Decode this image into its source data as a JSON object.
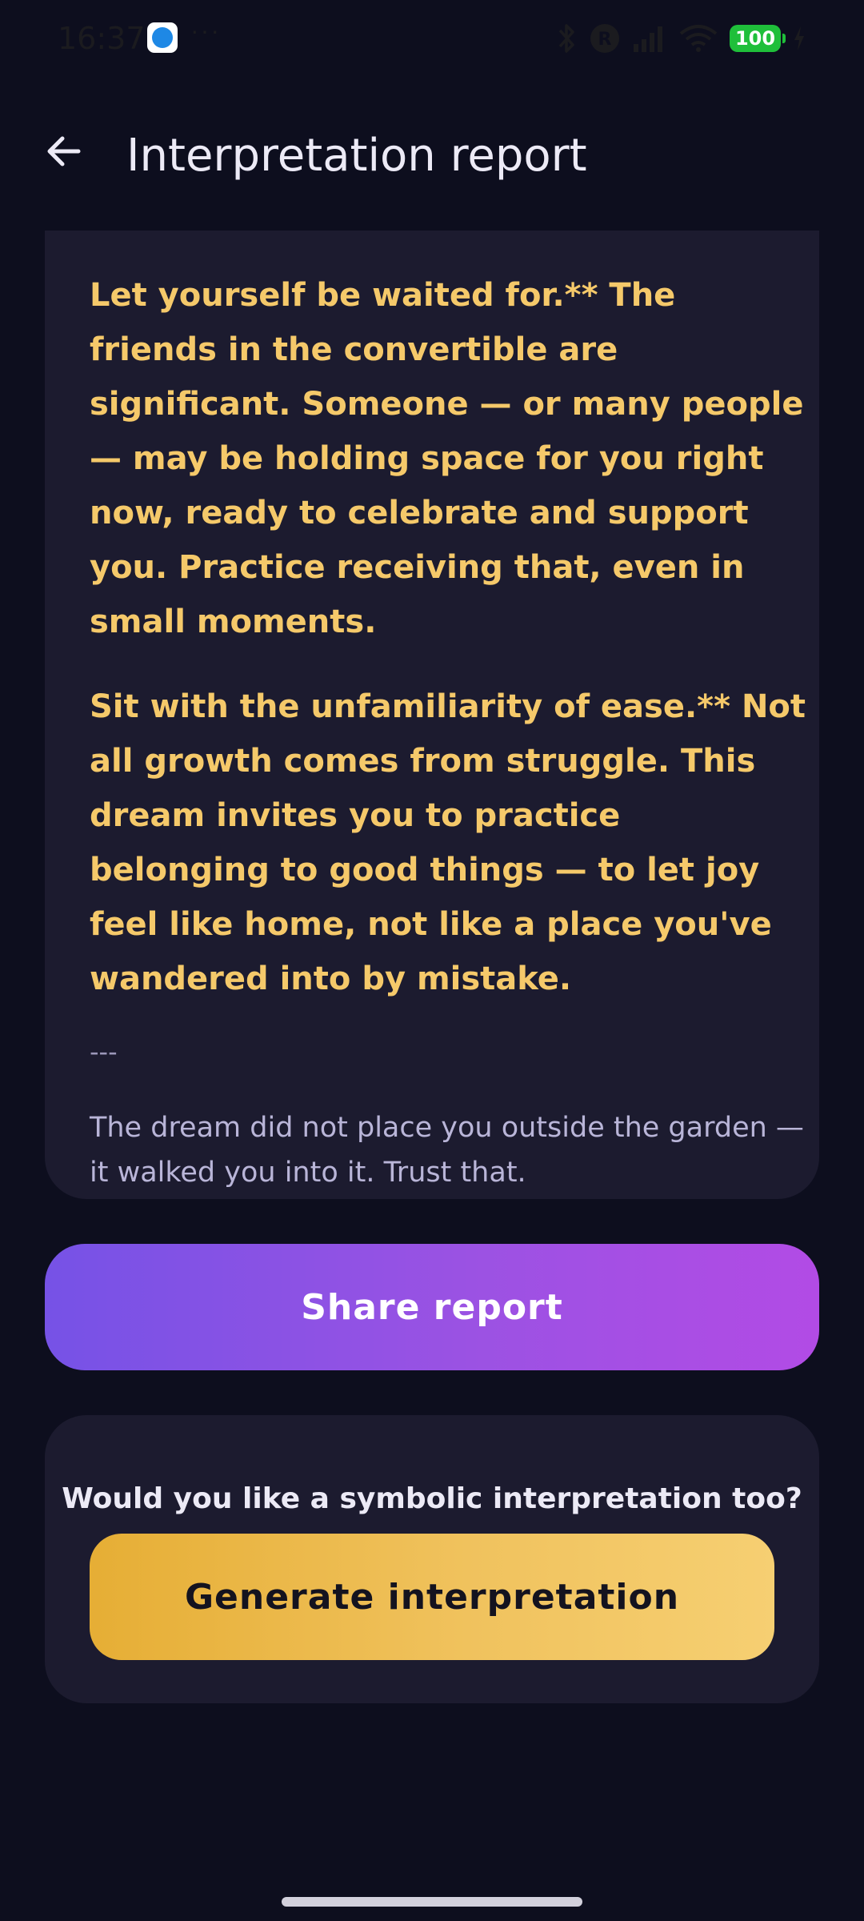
{
  "status_bar": {
    "time": "16:37",
    "overflow_dots": "···",
    "battery_level": "100",
    "icons": [
      "app-notification-icon",
      "bluetooth-icon",
      "r-badge-icon",
      "signal-icon",
      "wifi-icon",
      "battery-icon",
      "charging-icon"
    ]
  },
  "app_bar": {
    "title": "Interpretation report",
    "back_icon": "arrow-left-icon"
  },
  "report": {
    "paragraphs": [
      "Let yourself be waited for.** The friends in the convertible are significant. Someone — or many people — may be holding space for you right now, ready to celebrate and support you. Practice receiving that, even in small moments.",
      "Sit with the unfamiliarity of ease.** Not all growth comes from struggle. This dream invites you to practice belonging to good things — to let joy feel like home, not like a place you've wandered into by mistake."
    ],
    "divider": "---",
    "closing": "The dream did not place you outside the garden — it walked you into it. Trust that."
  },
  "actions": {
    "share_label": "Share report"
  },
  "symbolic": {
    "question": "Would you like a symbolic interpretation too?",
    "generate_label": "Generate interpretation"
  },
  "colors": {
    "background": "#0d0e1e",
    "card": "#1c1b2f",
    "report_text": "#f5c96a",
    "closing_text": "#b9b5d8",
    "share_gradient_start": "#7652e6",
    "share_gradient_end": "#b24be5",
    "generate_gradient_start": "#e6ae35",
    "generate_gradient_end": "#f6cf72",
    "battery": "#1fbf3a"
  }
}
